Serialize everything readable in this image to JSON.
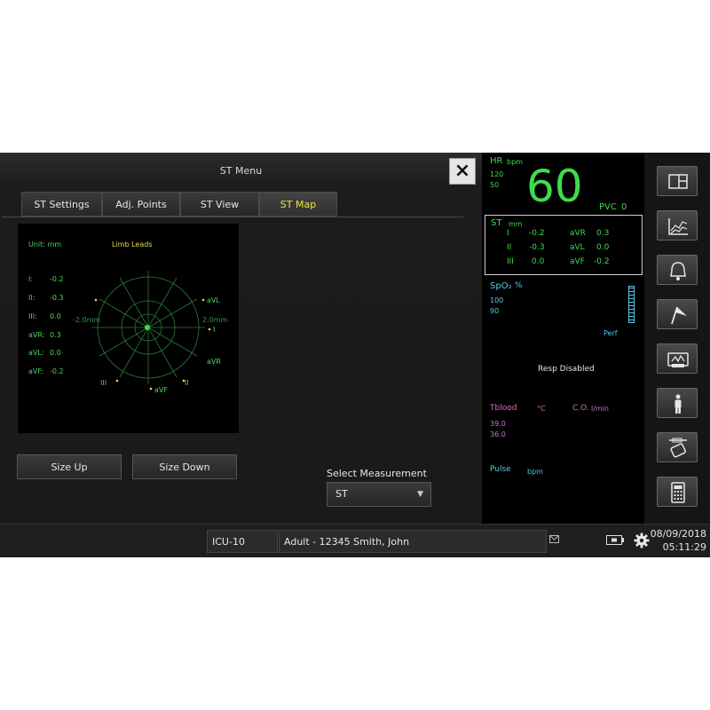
{
  "menu": {
    "title": "ST Menu",
    "close_label": "×",
    "tabs": [
      {
        "label": "ST Settings",
        "active": false
      },
      {
        "label": "Adj. Points",
        "active": false
      },
      {
        "label": "ST View",
        "active": false
      },
      {
        "label": "ST Map",
        "active": true
      }
    ]
  },
  "st_map": {
    "unit": "Unit: mm",
    "lead_group": "Limb Leads",
    "values": [
      {
        "lead": "I:",
        "value": "-0.2"
      },
      {
        "lead": "II:",
        "value": "-0.3"
      },
      {
        "lead": "III:",
        "value": "0.0"
      },
      {
        "lead": "aVR:",
        "value": "0.3"
      },
      {
        "lead": "aVL:",
        "value": "0.0"
      },
      {
        "lead": "aVF:",
        "value": "-0.2"
      }
    ],
    "scale_left": "-2.0mm",
    "scale_right": "2.0mm",
    "axis_labels": {
      "aVL": "aVL",
      "I": "I",
      "aVR": "aVR",
      "II": "II",
      "aVF": "aVF",
      "III": "III"
    }
  },
  "buttons": {
    "size_up": "Size Up",
    "size_down": "Size Down"
  },
  "select_measurement": {
    "label": "Select Measurement",
    "value": "ST",
    "arrow": "▼"
  },
  "vitals": {
    "hr": {
      "label": "HR",
      "unit": "bpm",
      "high": "120",
      "low": "50",
      "value": "60",
      "pvc_label": "PVC",
      "pvc_value": "0"
    },
    "st": {
      "label": "ST",
      "unit": "mm",
      "rows": [
        {
          "l1": "I",
          "v1": "-0.2",
          "l2": "aVR",
          "v2": "0.3"
        },
        {
          "l1": "II",
          "v1": "-0.3",
          "l2": "aVL",
          "v2": "0.0"
        },
        {
          "l1": "III",
          "v1": "0.0",
          "l2": "aVF",
          "v2": "-0.2"
        }
      ]
    },
    "spo2": {
      "label": "SpO₂",
      "unit": "%",
      "high": "100",
      "low": "90",
      "perf": "Perf"
    },
    "resp": "Resp Disabled",
    "tblood": {
      "label": "Tblood",
      "unit": "°C",
      "high": "39.0",
      "low": "36.0"
    },
    "co": {
      "label": "C.O.",
      "unit": "l/min"
    },
    "pulse": {
      "label": "Pulse",
      "unit": "bpm"
    }
  },
  "toolbar": [
    "monitor-layout-icon",
    "trends-icon",
    "alarm-bell-icon",
    "flag-icon",
    "print-icon",
    "patient-icon",
    "syringe-icon",
    "calculator-icon"
  ],
  "bottom": {
    "bed": "ICU-10",
    "patient": "Adult - 12345 Smith, John",
    "date": "08/09/2018",
    "time": "05:11:29"
  },
  "colors": {
    "green": "#3fdc4c",
    "cyan": "#58c9e8",
    "purple": "#d070d0",
    "yellow": "#f2e23a"
  }
}
